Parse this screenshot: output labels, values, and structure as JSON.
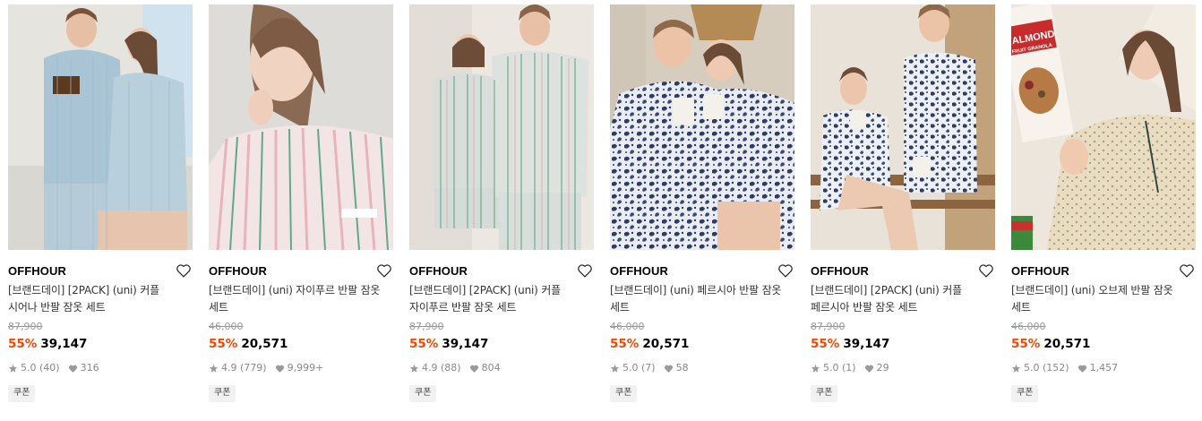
{
  "colors": {
    "discount": "#f04700",
    "brand": "#000000",
    "muted": "#999999",
    "coupon_bg": "#f1f1f1"
  },
  "products": [
    {
      "brand": "OFFHOUR",
      "name_line1": "[브랜드데이] [2PACK] (uni) 커플",
      "name_line2": "시어나 반팔 잠옷 세트",
      "original_price": "87,900",
      "discount": "55%",
      "price": "39,147",
      "rating": "5.0",
      "reviews": "(40)",
      "likes": "316",
      "coupon": "쿠폰",
      "image_desc": "couple in light blue striped pajamas"
    },
    {
      "brand": "OFFHOUR",
      "name_line1": "[브랜드데이] (uni) 자이푸르 반팔 잠옷",
      "name_line2": "세트",
      "original_price": "46,000",
      "discount": "55%",
      "price": "20,571",
      "rating": "4.9",
      "reviews": "(779)",
      "likes": "9,999+",
      "coupon": "쿠폰",
      "image_desc": "woman in pink green striped pajama"
    },
    {
      "brand": "OFFHOUR",
      "name_line1": "[브랜드데이] [2PACK] (uni) 커플",
      "name_line2": "자이푸르 반팔 잠옷 세트",
      "original_price": "87,900",
      "discount": "55%",
      "price": "39,147",
      "rating": "4.9",
      "reviews": "(88)",
      "likes": "804",
      "coupon": "쿠폰",
      "image_desc": "couple in striped pajamas"
    },
    {
      "brand": "OFFHOUR",
      "name_line1": "[브랜드데이] (uni) 페르시아 반팔 잠옷",
      "name_line2": "세트",
      "original_price": "46,000",
      "discount": "55%",
      "price": "20,571",
      "rating": "5.0",
      "reviews": "(7)",
      "likes": "58",
      "coupon": "쿠폰",
      "image_desc": "couple in navy paisley pajamas holding mugs"
    },
    {
      "brand": "OFFHOUR",
      "name_line1": "[브랜드데이] [2PACK] (uni) 커플",
      "name_line2": "페르시아 반팔 잠옷 세트",
      "original_price": "87,900",
      "discount": "55%",
      "price": "39,147",
      "rating": "5.0",
      "reviews": "(1)",
      "likes": "29",
      "coupon": "쿠폰",
      "image_desc": "couple in paisley pajamas seated on bench"
    },
    {
      "brand": "OFFHOUR",
      "name_line1": "[브랜드데이] (uni) 오브제 반팔 잠옷",
      "name_line2": "세트",
      "original_price": "46,000",
      "discount": "55%",
      "price": "20,571",
      "rating": "5.0",
      "reviews": "(152)",
      "likes": "1,457",
      "coupon": "쿠폰",
      "image_desc": "woman in beige floral pajama holding granola box",
      "image_text_line1": "ALMOND",
      "image_text_line2": "FRUIT GRANOLA"
    }
  ]
}
